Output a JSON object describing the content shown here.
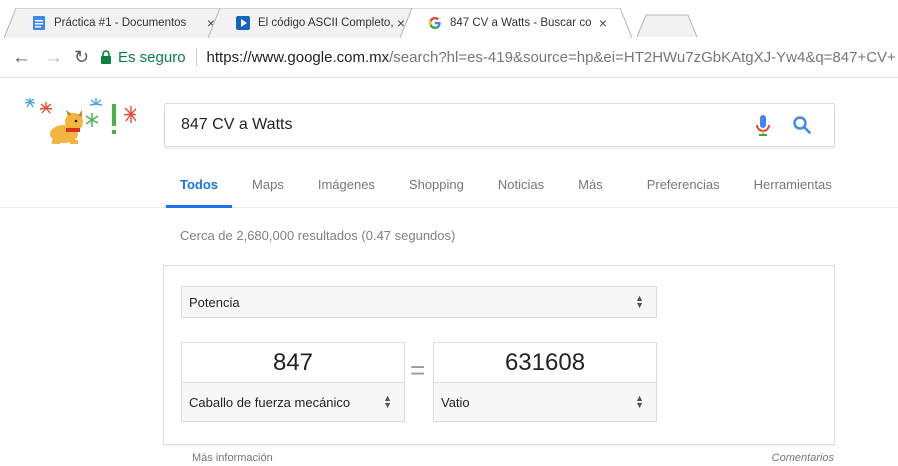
{
  "browser": {
    "tabs": [
      {
        "title": "Práctica #1 - Documentos",
        "favicon": "docs-icon"
      },
      {
        "title": "El código ASCII Completo,",
        "favicon": "play-icon"
      },
      {
        "title": "847 CV a Watts - Buscar co",
        "favicon": "google-g-icon"
      }
    ],
    "close_glyph": "×",
    "secure_label": "Es seguro",
    "url_host": "https://www.google.com.mx",
    "url_rest": "/search?hl=es-419&source=hp&ei=HT2HWu7zGbKAtgXJ-Yw4&q=847+CV+"
  },
  "search": {
    "query": "847 CV a Watts"
  },
  "nav_tabs": [
    {
      "label": "Todos",
      "active": true
    },
    {
      "label": "Maps"
    },
    {
      "label": "Imágenes"
    },
    {
      "label": "Shopping"
    },
    {
      "label": "Noticias"
    },
    {
      "label": "Más"
    },
    {
      "label": "Preferencias"
    },
    {
      "label": "Herramientas"
    }
  ],
  "stats": "Cerca de 2,680,000 resultados (0.47 segundos)",
  "converter": {
    "category": "Potencia",
    "from_value": "847",
    "from_unit": "Caballo de fuerza mecánico",
    "equals": "=",
    "to_value": "631608",
    "to_unit": "Vatio"
  },
  "footer": {
    "more_info": "Más información",
    "feedback": "Comentarios"
  },
  "colors": {
    "accent_blue": "#1a73e8",
    "secure_green": "#0b8043"
  }
}
